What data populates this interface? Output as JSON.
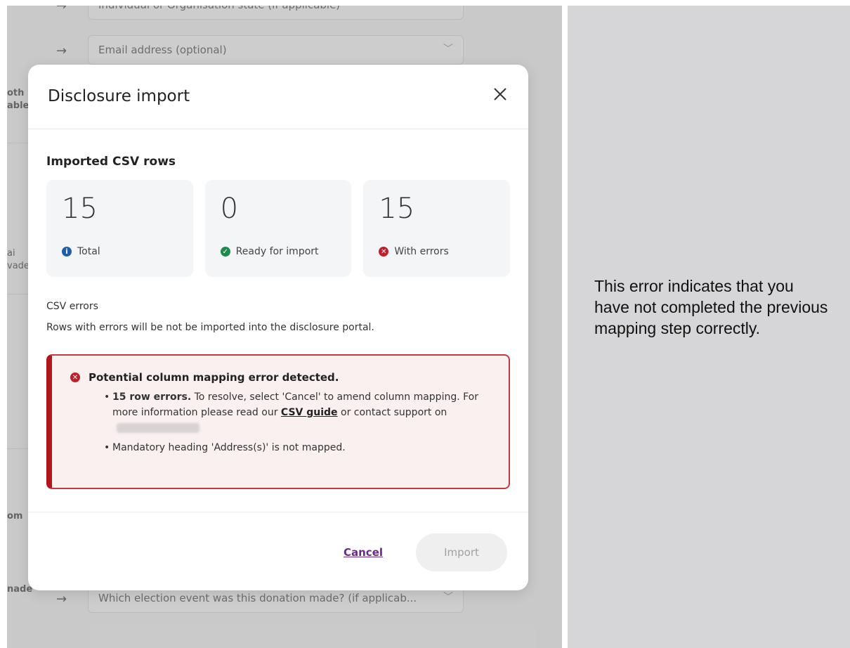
{
  "background": {
    "fields": [
      {
        "text": "Individual or Organisation state (if applicable)"
      },
      {
        "text": "Email address (optional)"
      },
      {
        "text": "Which election event was this donation made? (if applicab..."
      }
    ],
    "side_labels": [
      "oth",
      "able",
      "ai",
      "vade",
      "om",
      "nade"
    ]
  },
  "modal": {
    "title": "Disclosure import",
    "section_title": "Imported CSV rows",
    "stats": [
      {
        "value": "15",
        "label": "Total",
        "status": "info"
      },
      {
        "value": "0",
        "label": "Ready for import",
        "status": "ok"
      },
      {
        "value": "15",
        "label": "With errors",
        "status": "error"
      }
    ],
    "csv_errors_heading": "CSV errors",
    "csv_errors_description": "Rows with errors will be not be imported into the disclosure portal.",
    "alert": {
      "title": "Potential column mapping error detected.",
      "item1_bold": "15 row errors.",
      "item1_text": " To resolve, select 'Cancel' to amend column mapping. For more information please read our ",
      "item1_link": "CSV guide",
      "item1_text2": " or contact support on",
      "item2": "Mandatory heading 'Address(s)' is not mapped."
    },
    "cancel_label": "Cancel",
    "import_label": "Import"
  },
  "caption": "This error indicates that you have not completed the previous mapping step correctly.",
  "colors": {
    "error_red": "#c0202a",
    "info_blue": "#1f5fa8",
    "ok_green": "#1f8a4d",
    "link_purple": "#6a2a8a"
  }
}
